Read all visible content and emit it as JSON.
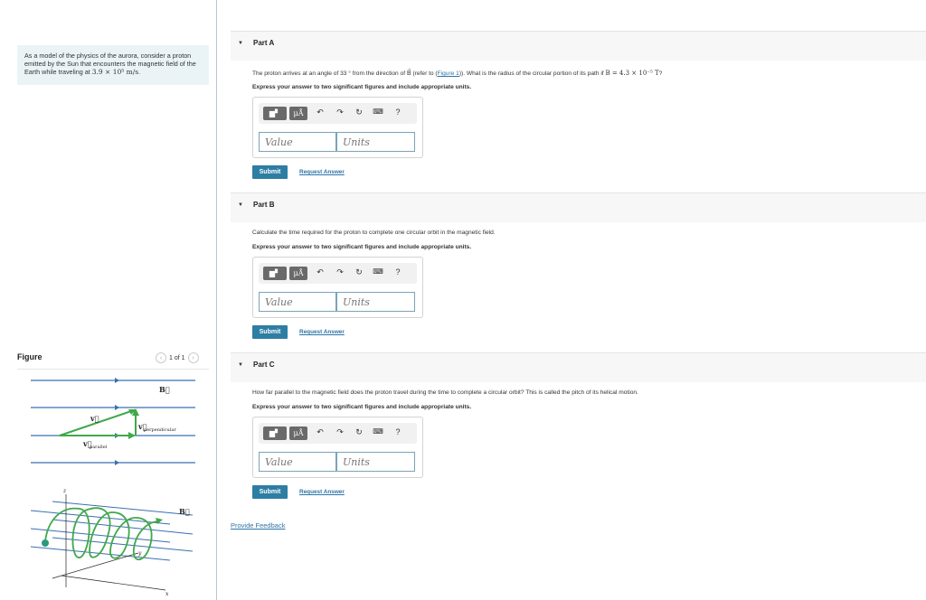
{
  "intro": {
    "text": "As a model of the physics of the aurora, consider a proton emitted by the Sun that encounters the magnetic field of the Earth while traveling at ",
    "speed": "3.9 × 10⁵ m/s",
    "end": "."
  },
  "figure": {
    "title": "Figure",
    "pager": "1 of 1",
    "labels": {
      "B": "B⃗",
      "v": "v⃗",
      "v_parallel": "v⃗",
      "v_parallel_sub": "parallel",
      "v_perp": "v⃗",
      "v_perp_sub": "perpendicular",
      "axis_z": "z",
      "axis_y": "y",
      "axis_x": "x"
    }
  },
  "parts": [
    {
      "label": "Part A",
      "question_pre": "The proton arrives at an angle of 33 ° from the direction of ",
      "question_vec": "B⃗",
      "question_mid": " (refer to (",
      "question_link": "Figure 1",
      "question_post": ")). What is the radius of the circular portion of its path if ",
      "question_math": "B = 4.3 × 10⁻⁵ T",
      "question_end": "?",
      "instruction": "Express your answer to two significant figures and include appropriate units.",
      "value_placeholder": "Value",
      "units_placeholder": "Units",
      "submit": "Submit",
      "request": "Request Answer"
    },
    {
      "label": "Part B",
      "question": "Calculate the time required for the proton to complete one circular orbit in the magnetic field.",
      "instruction": "Express your answer to two significant figures and include appropriate units.",
      "value_placeholder": "Value",
      "units_placeholder": "Units",
      "submit": "Submit",
      "request": "Request Answer"
    },
    {
      "label": "Part C",
      "question": "How far parallel to the magnetic field does the proton travel during the time to complete a circular orbit? This is called the pitch of its helical motion.",
      "instruction": "Express your answer to two significant figures and include appropriate units.",
      "value_placeholder": "Value",
      "units_placeholder": "Units",
      "submit": "Submit",
      "request": "Request Answer"
    }
  ],
  "toolbar": {
    "units_btn": "μÅ",
    "help": "?"
  },
  "feedback": "Provide Feedback"
}
